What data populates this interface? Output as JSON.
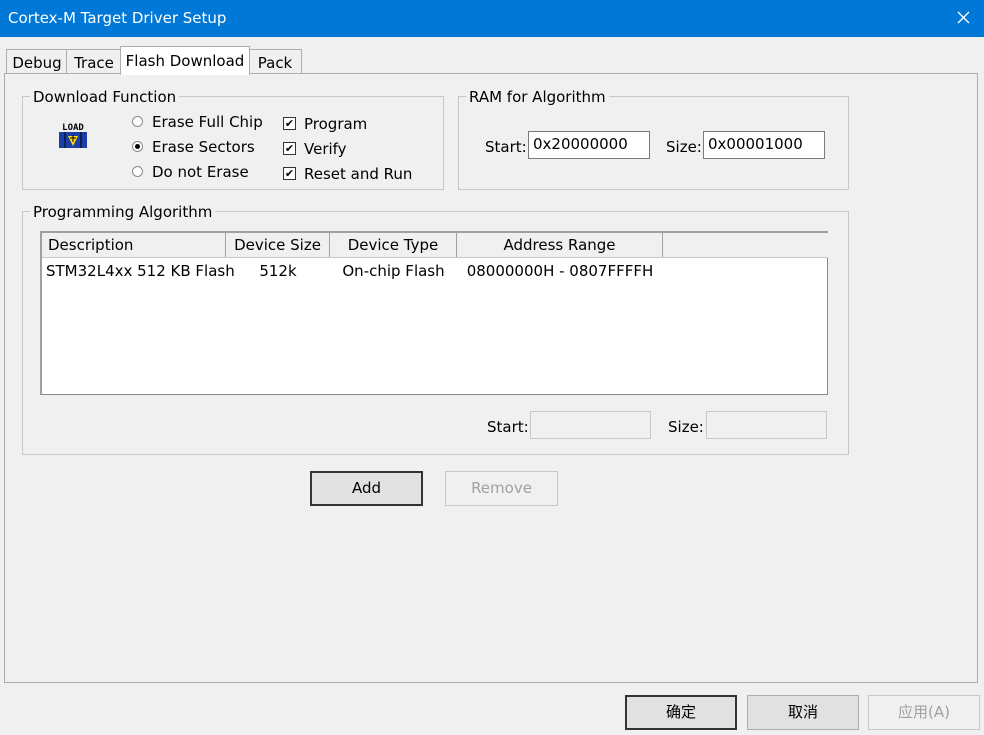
{
  "window": {
    "title": "Cortex-M Target Driver Setup",
    "close_icon": "close-icon"
  },
  "tabs": [
    {
      "label": "Debug"
    },
    {
      "label": "Trace"
    },
    {
      "label": "Flash Download",
      "active": true
    },
    {
      "label": "Pack"
    }
  ],
  "download_function": {
    "label": "Download Function",
    "icon": "load-icon",
    "icon_text": "LOAD",
    "erase_options": [
      {
        "label": "Erase Full Chip",
        "selected": false
      },
      {
        "label": "Erase Sectors",
        "selected": true
      },
      {
        "label": "Do not Erase",
        "selected": false
      }
    ],
    "checks": [
      {
        "label": "Program",
        "checked": true
      },
      {
        "label": "Verify",
        "checked": true
      },
      {
        "label": "Reset and Run",
        "checked": true
      }
    ]
  },
  "ram": {
    "label": "RAM for Algorithm",
    "start_label": "Start:",
    "start_value": "0x20000000",
    "size_label": "Size:",
    "size_value": "0x00001000"
  },
  "algorithm": {
    "label": "Programming Algorithm",
    "columns": [
      "Description",
      "Device Size",
      "Device Type",
      "Address Range"
    ],
    "rows": [
      [
        "STM32L4xx 512 KB Flash",
        "512k",
        "On-chip Flash",
        "08000000H - 0807FFFFH"
      ]
    ],
    "start_label": "Start:",
    "start_value": "",
    "size_label": "Size:",
    "size_value": ""
  },
  "buttons": {
    "add": "Add",
    "remove": "Remove",
    "ok": "确定",
    "cancel": "取消",
    "apply": "应用(A)"
  }
}
